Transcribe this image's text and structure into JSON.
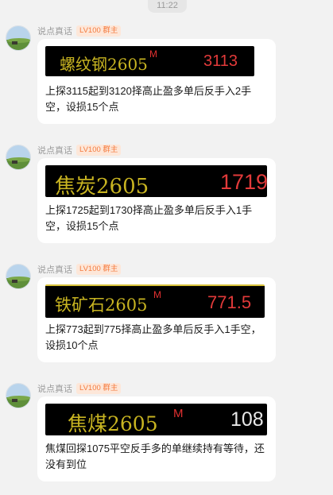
{
  "status": {
    "time": "11:22"
  },
  "messages": [
    {
      "sender": "说点真话",
      "badge": "LV100 群主",
      "ticker": {
        "name": "螺纹钢2605",
        "flag": "M",
        "price": "3113",
        "price_color": "#e23a3a"
      },
      "text": "上探3115起到3120择高止盈多单后反手入2手空，设损15个点"
    },
    {
      "sender": "说点真话",
      "badge": "LV100 群主",
      "ticker": {
        "name": "焦炭2605",
        "flag": "",
        "price": "1719",
        "price_color": "#e23a3a"
      },
      "text": "上探1725起到1730择高止盈多单后反手入1手空，设损15个点"
    },
    {
      "sender": "说点真话",
      "badge": "LV100 群主",
      "ticker": {
        "name": "铁矿石2605",
        "flag": "M",
        "price": "771.5",
        "price_color": "#e23a3a"
      },
      "text": "上探773起到775择高止盈多单后反手入1手空，设损10个点"
    },
    {
      "sender": "说点真话",
      "badge": "LV100 群主",
      "ticker": {
        "name": "焦煤2605",
        "flag": "M",
        "price": "108",
        "price_color": "#e8e8e8"
      },
      "text": "焦煤回探1075平空反手多的单继续持有等待，还没有到位"
    }
  ],
  "colors": {
    "background": "#f2f2f2",
    "bubble": "#ffffff",
    "ticker_name": "#c8b421",
    "badge_text": "#f47b3f",
    "badge_bg": "#fde7d9"
  }
}
